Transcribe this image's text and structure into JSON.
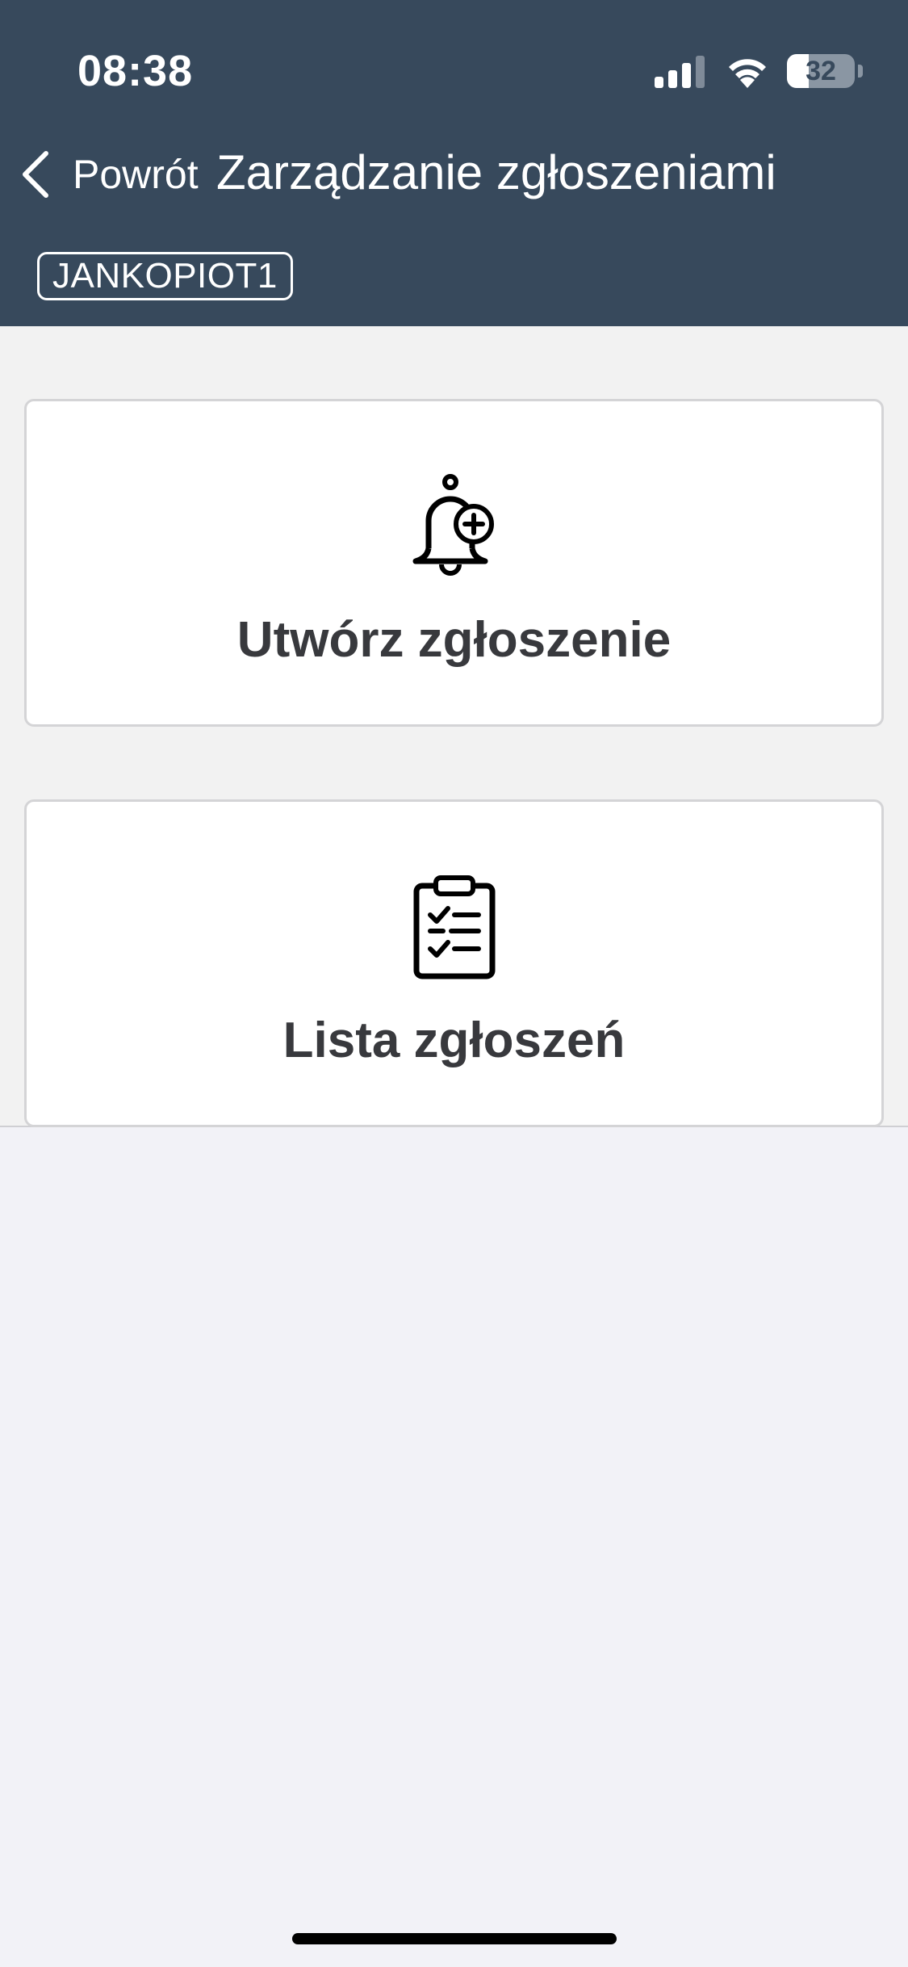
{
  "status_bar": {
    "time": "08:38",
    "battery_level": "32",
    "battery_fraction": 0.32,
    "icons": [
      "signal-icon",
      "wifi-icon",
      "battery-icon"
    ]
  },
  "header": {
    "back_label": "Powrót",
    "back_icon": "chevron-left-icon",
    "title": "Zarządzanie zgłoszeniami",
    "user_badge": "JANKOPIOT1",
    "background_color": "#37495c"
  },
  "cards": [
    {
      "icon": "bell-plus-icon",
      "label": "Utwórz zgłoszenie"
    },
    {
      "icon": "clipboard-checklist-icon",
      "label": "Lista zgłoszeń"
    }
  ]
}
